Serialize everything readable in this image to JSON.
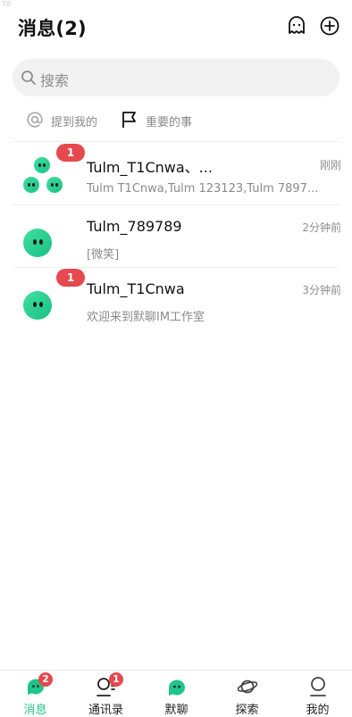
{
  "corner_mark": "T8",
  "header": {
    "title": "消息(2)"
  },
  "search": {
    "placeholder": "搜索"
  },
  "quick_links": [
    {
      "label": "提到我的",
      "icon": "at-icon"
    },
    {
      "label": "重要的事",
      "icon": "flag-icon"
    }
  ],
  "conversations": [
    {
      "name": "Tulm_T1Cnwa、...",
      "time": "刚刚",
      "preview": "Tulm T1Cnwa,Tulm 123123,Tulm 7897...",
      "badge": "1",
      "avatar": "group-avatar"
    },
    {
      "name": "Tulm_789789",
      "time": "2分钟前",
      "preview": "[微笑]",
      "badge": "",
      "avatar": "bot-avatar"
    },
    {
      "name": "Tulm_T1Cnwa",
      "time": "3分钟前",
      "preview": "欢迎来到默聊IM工作室",
      "badge": "1",
      "avatar": "bot-avatar"
    }
  ],
  "tabbar": [
    {
      "label": "消息",
      "badge": "2",
      "icon": "chat-bubble-icon",
      "active": true
    },
    {
      "label": "通讯录",
      "badge": "1",
      "icon": "contacts-icon",
      "active": false
    },
    {
      "label": "默聊",
      "badge": "",
      "icon": "bot-icon",
      "active": false
    },
    {
      "label": "探索",
      "badge": "",
      "icon": "planet-icon",
      "active": false
    },
    {
      "label": "我的",
      "badge": "",
      "icon": "profile-icon",
      "active": false
    }
  ],
  "colors": {
    "accent": "#1ec48a",
    "badge": "#e5484d"
  }
}
